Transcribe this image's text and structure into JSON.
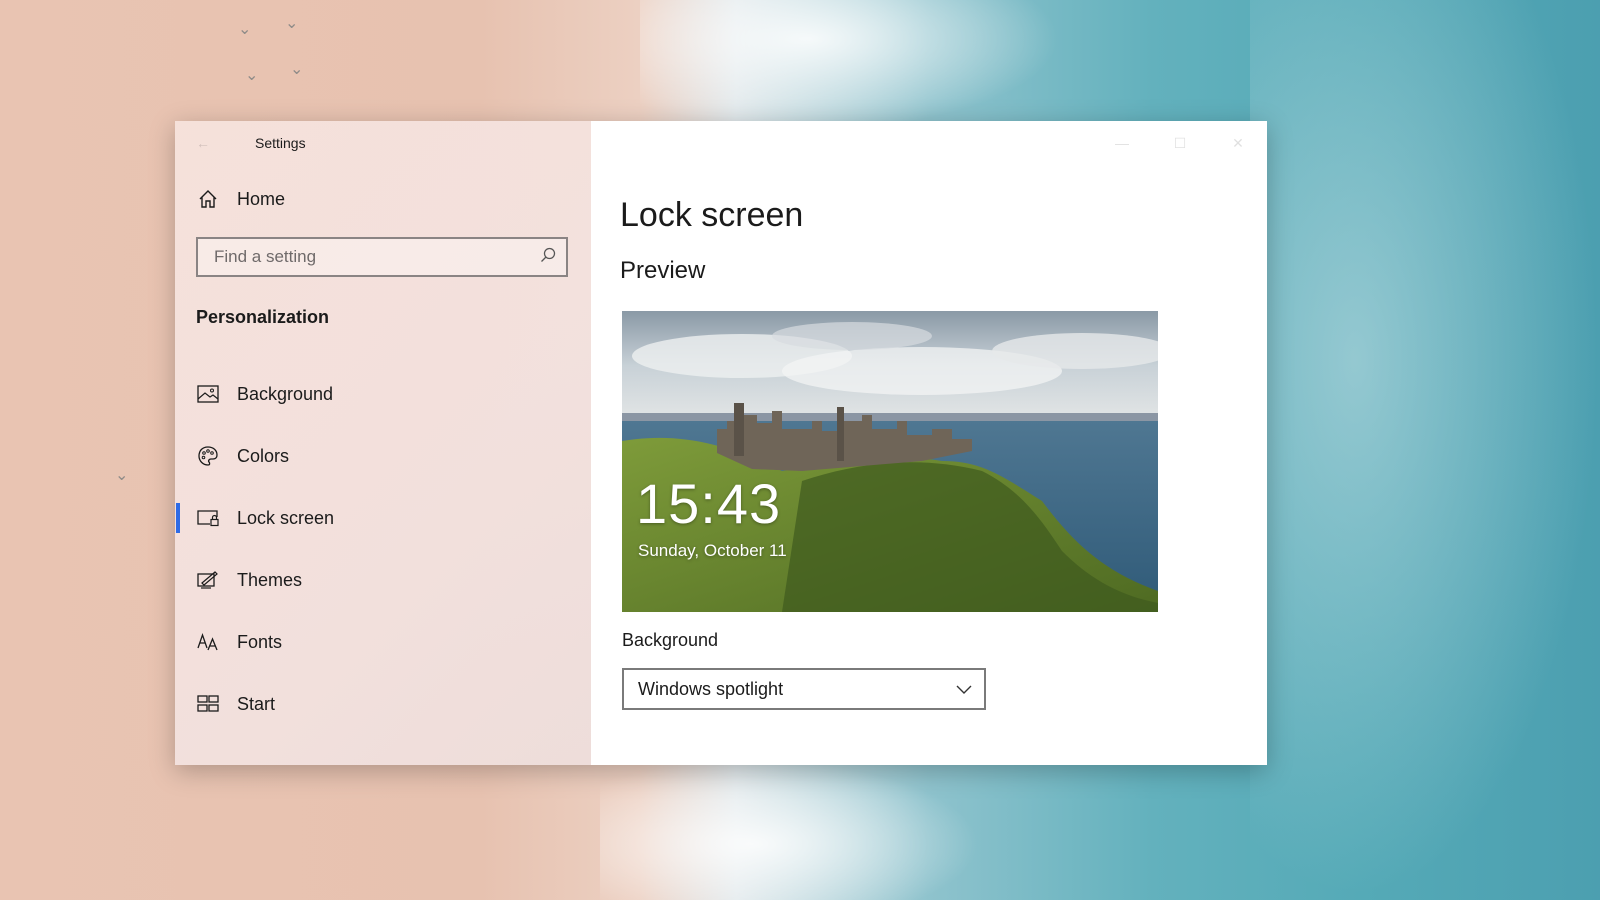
{
  "window": {
    "title": "Settings"
  },
  "sidebar": {
    "home_label": "Home",
    "search": {
      "placeholder": "Find a setting",
      "value": ""
    },
    "section_header": "Personalization",
    "items": [
      {
        "label": "Background",
        "icon": "picture-icon"
      },
      {
        "label": "Colors",
        "icon": "palette-icon"
      },
      {
        "label": "Lock screen",
        "icon": "lock-screen-icon",
        "selected": true
      },
      {
        "label": "Themes",
        "icon": "themes-icon"
      },
      {
        "label": "Fonts",
        "icon": "fonts-icon"
      },
      {
        "label": "Start",
        "icon": "start-icon"
      }
    ]
  },
  "content": {
    "page_title": "Lock screen",
    "preview_heading": "Preview",
    "preview": {
      "time": "15:43",
      "date": "Sunday, October 11"
    },
    "background_label": "Background",
    "background_select": {
      "selected": "Windows spotlight"
    }
  },
  "colors": {
    "accent": "#2e6be6",
    "sidebar_bg": "#f3e2df",
    "content_bg": "#ffffff"
  }
}
